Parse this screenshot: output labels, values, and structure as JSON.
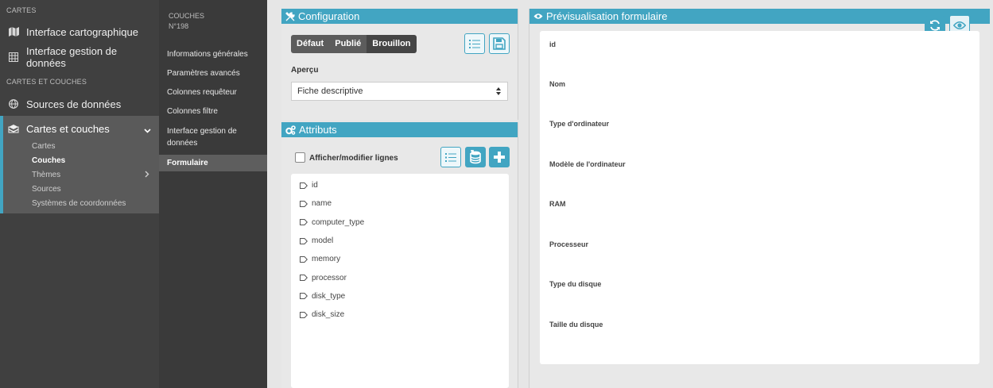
{
  "sidebar": {
    "section1": "CARTES",
    "map_ui": "Interface cartographique",
    "data_ui": "Interface gestion de données",
    "section2": "CARTES ET COUCHES",
    "datasources": "Sources de données",
    "maps_layers": "Cartes et couches",
    "sub": [
      "Cartes",
      "Couches",
      "Thèmes",
      "Sources",
      "Systèmes de coordonnées"
    ]
  },
  "subnav": {
    "title": "COUCHES",
    "number": "N°198",
    "items": [
      "Informations générales",
      "Paramètres avancés",
      "Colonnes requêteur",
      "Colonnes filtre",
      "Interface gestion de données",
      "Formulaire"
    ]
  },
  "config": {
    "title": "Configuration",
    "segments": [
      "Défaut",
      "Publié",
      "Brouillon"
    ],
    "apercu_label": "Aperçu",
    "apercu_value": "Fiche descriptive"
  },
  "attributes": {
    "title": "Attributs",
    "checkbox_label": "Afficher/modifier lignes",
    "items": [
      "id",
      "name",
      "computer_type",
      "model",
      "memory",
      "processor",
      "disk_type",
      "disk_size"
    ]
  },
  "preview": {
    "title": "Prévisualisation formulaire",
    "fields": [
      "id",
      "Nom",
      "Type d'ordinateur",
      "Modèle de l'ordinateur",
      "RAM",
      "Processeur",
      "Type du disque",
      "Taille du disque"
    ]
  },
  "colors": {
    "accent": "#42a5c2",
    "sidebar": "#404040",
    "subnav": "#3a3a3a"
  },
  "icons": [
    "map-icon",
    "grid-icon",
    "globe-icon",
    "layers-icon",
    "chevron-down-icon",
    "chevron-right-icon",
    "tools-icon",
    "cogs-icon",
    "list-icon",
    "save-icon",
    "database-icon",
    "plus-icon",
    "tag-icon",
    "refresh-icon",
    "eye-icon",
    "select-caret-icon"
  ]
}
